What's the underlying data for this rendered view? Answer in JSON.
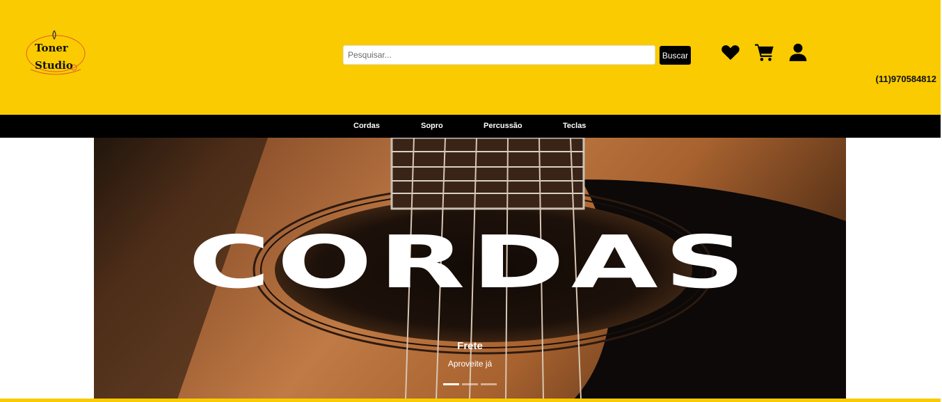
{
  "logo": {
    "line1": "Toner",
    "line2": "Studio"
  },
  "search": {
    "placeholder": "Pesquisar...",
    "value": "",
    "button_label": "Buscar"
  },
  "header_icons": [
    "heart-icon",
    "cart-icon",
    "user-icon"
  ],
  "phone": "(11)970584812",
  "nav": {
    "items": [
      "Cordas",
      "Sopro",
      "Percussão",
      "Teclas"
    ]
  },
  "carousel": {
    "banner_text": "CORDAS",
    "caption_title": "Frete",
    "caption_text": "Aproveite já",
    "slide_count": 3,
    "active_slide": 1
  },
  "colors": {
    "brand_yellow": "#f9cb00",
    "nav_black": "#000000"
  }
}
